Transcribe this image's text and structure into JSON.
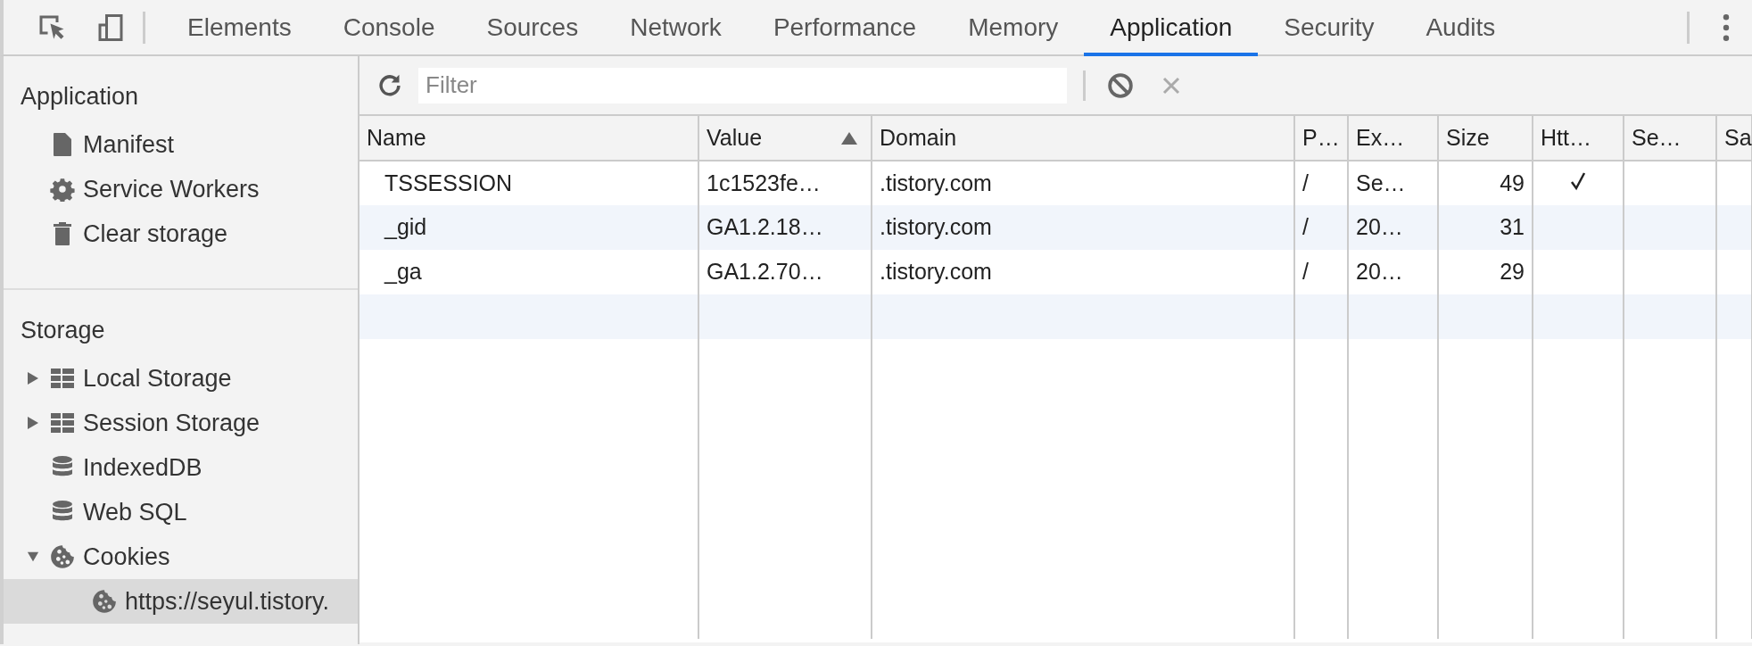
{
  "top_tabs": [
    {
      "label": "Elements",
      "selected": false
    },
    {
      "label": "Console",
      "selected": false
    },
    {
      "label": "Sources",
      "selected": false
    },
    {
      "label": "Network",
      "selected": false
    },
    {
      "label": "Performance",
      "selected": false
    },
    {
      "label": "Memory",
      "selected": false
    },
    {
      "label": "Application",
      "selected": true
    },
    {
      "label": "Security",
      "selected": false
    },
    {
      "label": "Audits",
      "selected": false
    }
  ],
  "sidebar": {
    "sections": [
      {
        "title": "Application",
        "items": [
          {
            "label": "Manifest",
            "kind": "file",
            "selected": false
          },
          {
            "label": "Service Workers",
            "kind": "gear",
            "selected": false
          },
          {
            "label": "Clear storage",
            "kind": "trash",
            "selected": false
          }
        ]
      },
      {
        "title": "Storage",
        "items": [
          {
            "label": "Local Storage",
            "kind": "table",
            "expanded": false,
            "selected": false
          },
          {
            "label": "Session Storage",
            "kind": "table",
            "expanded": false,
            "selected": false
          },
          {
            "label": "IndexedDB",
            "kind": "database",
            "selected": false
          },
          {
            "label": "Web SQL",
            "kind": "database",
            "selected": false
          },
          {
            "label": "Cookies",
            "kind": "cookie",
            "expanded": true,
            "selected": false,
            "children": [
              {
                "label": "https://seyul.tistory.",
                "kind": "cookie",
                "selected": true
              }
            ]
          }
        ]
      }
    ]
  },
  "toolbar": {
    "filter": {
      "placeholder": "Filter"
    }
  },
  "table": {
    "columns": [
      {
        "label": "Name",
        "sorted": false
      },
      {
        "label": "Value",
        "sorted": true
      },
      {
        "label": "Domain",
        "sorted": false
      },
      {
        "label": "P…",
        "sorted": false
      },
      {
        "label": "Ex…",
        "sorted": false
      },
      {
        "label": "Size",
        "sorted": false
      },
      {
        "label": "Htt…",
        "sorted": false
      },
      {
        "label": "Se…",
        "sorted": false
      },
      {
        "label": "Sa",
        "sorted": false
      }
    ],
    "rows": [
      {
        "name": "TSSESSION",
        "value": "1c1523fe…",
        "domain": ".tistory.com",
        "path": "/",
        "expires": "Se…",
        "size": "49",
        "http_only": true
      },
      {
        "name": "_gid",
        "value": "GA1.2.18…",
        "domain": ".tistory.com",
        "path": "/",
        "expires": "20…",
        "size": "31",
        "http_only": false
      },
      {
        "name": "_ga",
        "value": "GA1.2.70…",
        "domain": ".tistory.com",
        "path": "/",
        "expires": "20…",
        "size": "29",
        "http_only": false
      }
    ]
  }
}
